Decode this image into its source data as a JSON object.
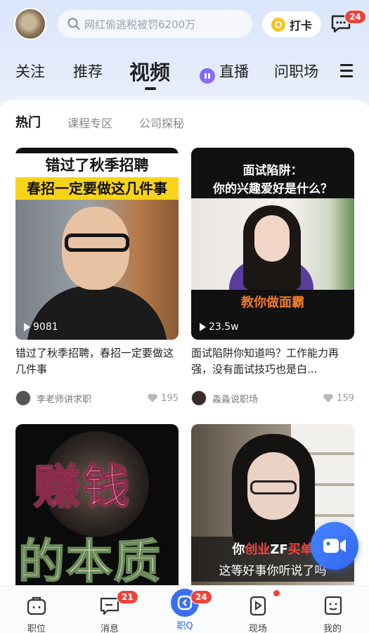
{
  "header": {
    "search_placeholder": "网红偷逃税被罚6200万",
    "checkin_label": "打卡",
    "messages_badge": "24"
  },
  "nav": {
    "tabs": [
      {
        "label": "关注"
      },
      {
        "label": "推荐"
      },
      {
        "label": "视频",
        "active": true
      },
      {
        "label": "直播"
      },
      {
        "label": "问职场"
      }
    ]
  },
  "subtabs": [
    {
      "label": "热门",
      "active": true
    },
    {
      "label": "课程专区"
    },
    {
      "label": "公司探秘"
    }
  ],
  "videos": [
    {
      "thumb_line1": "错过了秋季招聘",
      "thumb_line2": "春招一定要做这几件事",
      "plays": "9081",
      "caption": "错过了秋季招聘，春招一定要做这几件事",
      "author": "李老师讲求职",
      "likes": "195"
    },
    {
      "thumb_line1": "面试陷阱：",
      "thumb_line2": "你的兴趣爱好是什么？",
      "thumb_cta": "教你做面霸",
      "plays": "23.5w",
      "caption": "面试陷阱你知道吗？工作能力再强，没有面试技巧也是白...",
      "author": "淼淼说职场",
      "likes": "159"
    },
    {
      "thumb_line1": "赚钱",
      "thumb_line2": "的本质"
    },
    {
      "thumb_line1_a": "你",
      "thumb_line1_b": "创业",
      "thumb_line1_c": "ZF",
      "thumb_line1_d": "买单",
      "thumb_line2": "这等好事你听说了吗"
    }
  ],
  "bottom_nav": [
    {
      "label": "职位"
    },
    {
      "label": "消息",
      "badge": "21"
    },
    {
      "label": "职Q",
      "badge": "24",
      "active": true
    },
    {
      "label": "现场"
    },
    {
      "label": "我的"
    }
  ],
  "colors": {
    "accent": "#2f67ef",
    "badge": "#f0423a",
    "highlight_yellow": "#f7d418"
  }
}
